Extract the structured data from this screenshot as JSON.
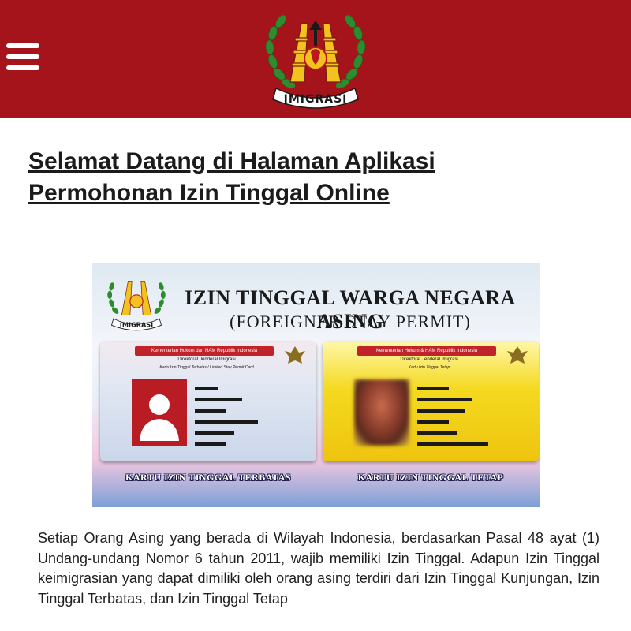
{
  "header": {
    "logo_text": "IMIGRASI",
    "background_color": "#a5141b",
    "menu_icon": "hamburger-menu-icon"
  },
  "page": {
    "title": "Selamat Datang di Halaman Aplikasi Permohonan Izin Tinggal Online"
  },
  "banner": {
    "logo_text": "IMIGRASI",
    "title": "IZIN TINGGAL WARGA NEGARA ASING",
    "subtitle": "(FOREIGNER STAY PERMIT)",
    "cards": [
      {
        "ministry": "Kementerian Hukum dan HAM Republik Indonesia",
        "directorate": "Direktorat Jenderal Imigrasi",
        "card_type": "Kartu Izin Tinggal Terbatas / Limited Stay Permit Card",
        "caption": "KARTU IZIN TINGGAL TERBATAS"
      },
      {
        "ministry": "Kementerian Hukum & HAM Republik Indonesia",
        "directorate": "Direktorat Jenderal Imigrasi",
        "card_type": "Kartu Izin Tinggal Tetap",
        "caption": "KARTU IZIN TINGGAL TETAP"
      }
    ]
  },
  "intro": {
    "text": "Setiap Orang Asing yang berada di Wilayah Indonesia, berdasarkan Pasal 48 ayat (1) Undang-undang Nomor 6 tahun 2011, wajib memiliki Izin Tinggal. Adapun Izin Tinggal keimigrasian yang dapat dimiliki oleh orang asing terdiri dari Izin Tinggal Kunjungan, Izin Tinggal Terbatas, dan Izin Tinggal Tetap"
  }
}
